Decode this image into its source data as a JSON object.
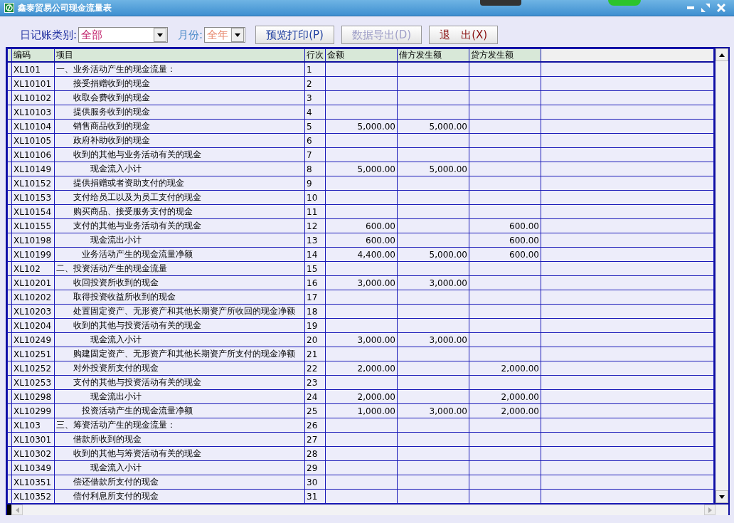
{
  "window": {
    "title": "鑫泰贸易公司现金流量表"
  },
  "toolbar": {
    "filters": [
      {
        "label": "日记账类别:",
        "value": "全部",
        "disabled": false
      },
      {
        "label": "月份:",
        "value": "全年",
        "disabled": true
      }
    ],
    "buttons": [
      {
        "label": "预览打印(P)",
        "disabled": false
      },
      {
        "label": "数据导出(D)",
        "disabled": true
      },
      {
        "label": "退　出(X)",
        "disabled": false
      }
    ]
  },
  "table": {
    "columns": [
      "编码",
      "项目",
      "行次",
      "金额",
      "借方发生额",
      "贷方发生额"
    ],
    "rows": [
      {
        "code": "XL101",
        "kind": "section",
        "item": "一、业务活动产生的现金流量：",
        "line": "1"
      },
      {
        "code": "XL10101",
        "kind": "item",
        "item": "接受捐赠收到的现金",
        "line": "2"
      },
      {
        "code": "XL10102",
        "kind": "item",
        "item": "收取会费收到的现金",
        "line": "3"
      },
      {
        "code": "XL10103",
        "kind": "item",
        "item": "提供服务收到的现金",
        "line": "4"
      },
      {
        "code": "XL10104",
        "kind": "item",
        "item": "销售商品收到的现金",
        "line": "5",
        "amount": "5,000.00",
        "debit": "5,000.00"
      },
      {
        "code": "XL10105",
        "kind": "item",
        "item": "政府补助收到的现金",
        "line": "6"
      },
      {
        "code": "XL10106",
        "kind": "item",
        "item": "收到的其他与业务活动有关的现金",
        "line": "7"
      },
      {
        "code": "XL10149",
        "kind": "subtotal",
        "item": "现金流入小计",
        "line": "8",
        "amount": "5,000.00",
        "debit": "5,000.00"
      },
      {
        "code": "XL10152",
        "kind": "item",
        "item": "提供捐赠或者资助支付的现金",
        "line": "9"
      },
      {
        "code": "XL10153",
        "kind": "item",
        "item": "支付给员工以及为员工支付的现金",
        "line": "10"
      },
      {
        "code": "XL10154",
        "kind": "item",
        "item": "购买商品、接受服务支付的现金",
        "line": "11"
      },
      {
        "code": "XL10155",
        "kind": "item",
        "item": "支付的其他与业务活动有关的现金",
        "line": "12",
        "amount": "600.00",
        "credit": "600.00"
      },
      {
        "code": "XL10198",
        "kind": "subtotal",
        "item": "现金流出小计",
        "line": "13",
        "amount": "600.00",
        "credit": "600.00"
      },
      {
        "code": "XL10199",
        "kind": "net",
        "item": "业务活动产生的现金流量净额",
        "line": "14",
        "amount": "4,400.00",
        "debit": "5,000.00",
        "credit": "600.00"
      },
      {
        "code": "XL102",
        "kind": "section",
        "item": "二、投资活动产生的现金流量",
        "line": "15"
      },
      {
        "code": "XL10201",
        "kind": "item",
        "item": "收回投资所收到的现金",
        "line": "16",
        "amount": "3,000.00",
        "debit": "3,000.00"
      },
      {
        "code": "XL10202",
        "kind": "item",
        "item": "取得投资收益所收到的现金",
        "line": "17"
      },
      {
        "code": "XL10203",
        "kind": "item",
        "item": "处置固定资产、无形资产和其他长期资产所收回的现金净额",
        "line": "18"
      },
      {
        "code": "XL10204",
        "kind": "item",
        "item": "收到的其他与投资活动有关的现金",
        "line": "19"
      },
      {
        "code": "XL10249",
        "kind": "subtotal",
        "item": "现金流入小计",
        "line": "20",
        "amount": "3,000.00",
        "debit": "3,000.00"
      },
      {
        "code": "XL10251",
        "kind": "item",
        "item": "购建固定资产、无形资产和其他长期资产所支付的现金净额",
        "line": "21"
      },
      {
        "code": "XL10252",
        "kind": "item",
        "item": "对外投资所支付的现金",
        "line": "22",
        "amount": "2,000.00",
        "credit": "2,000.00"
      },
      {
        "code": "XL10253",
        "kind": "item",
        "item": "支付的其他与投资活动有关的现金",
        "line": "23"
      },
      {
        "code": "XL10298",
        "kind": "subtotal",
        "item": "现金流出小计",
        "line": "24",
        "amount": "2,000.00",
        "credit": "2,000.00"
      },
      {
        "code": "XL10299",
        "kind": "net",
        "item": "投资活动产生的现金流量净额",
        "line": "25",
        "amount": "1,000.00",
        "debit": "3,000.00",
        "credit": "2,000.00"
      },
      {
        "code": "XL103",
        "kind": "section",
        "item": "三、筹资活动产生的现金流量：",
        "line": "26"
      },
      {
        "code": "XL10301",
        "kind": "item",
        "item": "借款所收到的现金",
        "line": "27"
      },
      {
        "code": "XL10302",
        "kind": "item",
        "item": "收到的其他与筹资活动有关的现金",
        "line": "28"
      },
      {
        "code": "XL10349",
        "kind": "subtotal",
        "item": "现金流入小计",
        "line": "29"
      },
      {
        "code": "XL10351",
        "kind": "item",
        "item": "偿还借款所支付的现金",
        "line": "30"
      },
      {
        "code": "XL10352",
        "kind": "item",
        "item": "偿付利息所支付的现金",
        "line": "31"
      }
    ]
  }
}
